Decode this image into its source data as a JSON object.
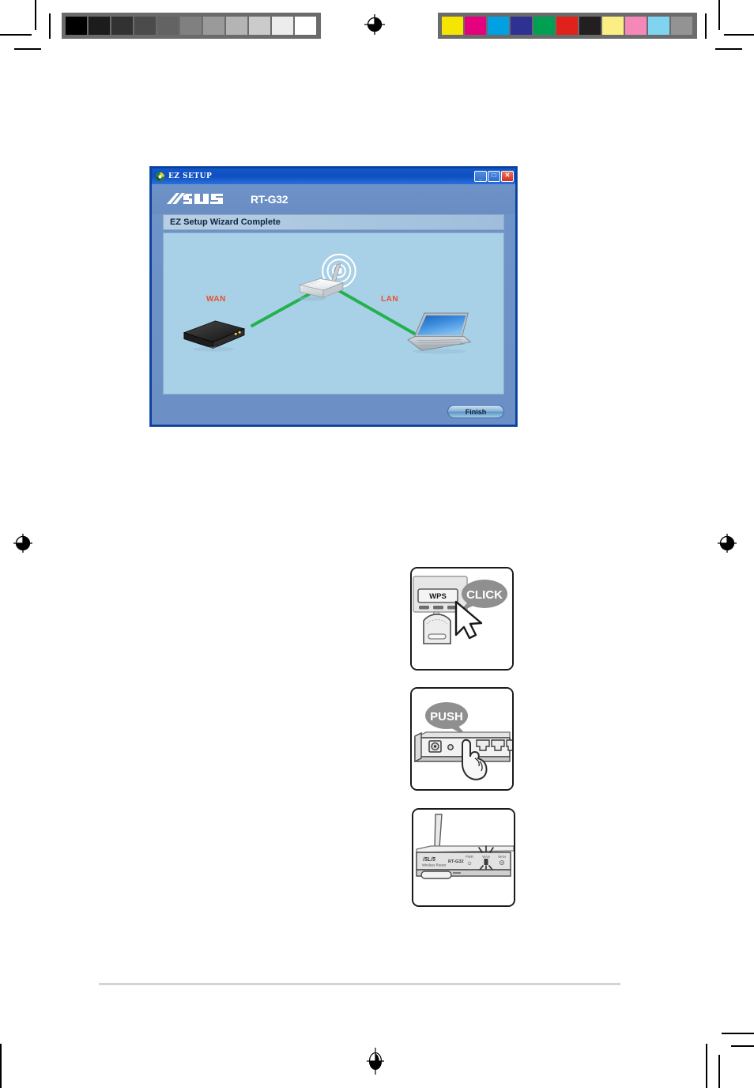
{
  "page": {
    "background_color": "#ffffff",
    "footer_rule_color": "#d2d4d6"
  },
  "print_marks": {
    "grayscale_bar": {
      "label": "grayscale-calibration-bar",
      "swatches": [
        "#000000",
        "#1c1c1c",
        "#323232",
        "#4b4b4b",
        "#636363",
        "#808080",
        "#9a9a9a",
        "#b4b4b4",
        "#cbcbcb",
        "#ececec",
        "#ffffff"
      ]
    },
    "color_bar": {
      "label": "color-calibration-bar",
      "swatches": [
        "#f6e500",
        "#e5007e",
        "#00a0e2",
        "#2e3192",
        "#00a053",
        "#e1211b",
        "#231f20",
        "#faee84",
        "#f489b9",
        "#7fd4f2",
        "#939393"
      ]
    },
    "registration_marks": 4
  },
  "ez_setup": {
    "titlebar": {
      "title": "EZ SETUP",
      "app_icon": "ez-setup-app-icon",
      "minimize_glyph": "_",
      "maximize_glyph": "□",
      "close_glyph": "✕"
    },
    "brand": {
      "logo_text": "ASUS",
      "model": "RT-G32"
    },
    "section_header": "EZ Setup Wizard Complete",
    "diagram": {
      "wan_label": "WAN",
      "lan_label": "LAN",
      "label_color": "#e8522a",
      "cable_color": "#22b14c",
      "nodes": [
        "modem",
        "wireless-router",
        "laptop"
      ],
      "panel_background": "#a8d0e6"
    },
    "finish_button": "Finish"
  },
  "instructions": {
    "photos": [
      {
        "name": "wps-software-click",
        "bubble": "CLICK",
        "button_label": "WPS",
        "pointer": "mouse-cursor"
      },
      {
        "name": "router-wps-push",
        "bubble": "PUSH",
        "pointer": "finger"
      },
      {
        "name": "router-led-blinking",
        "brand": "ASUS",
        "sub_brand": "Wireless Router",
        "model": "RT-G32",
        "led_labels": [
          "PWR",
          "WAN",
          "WAN"
        ]
      }
    ]
  }
}
